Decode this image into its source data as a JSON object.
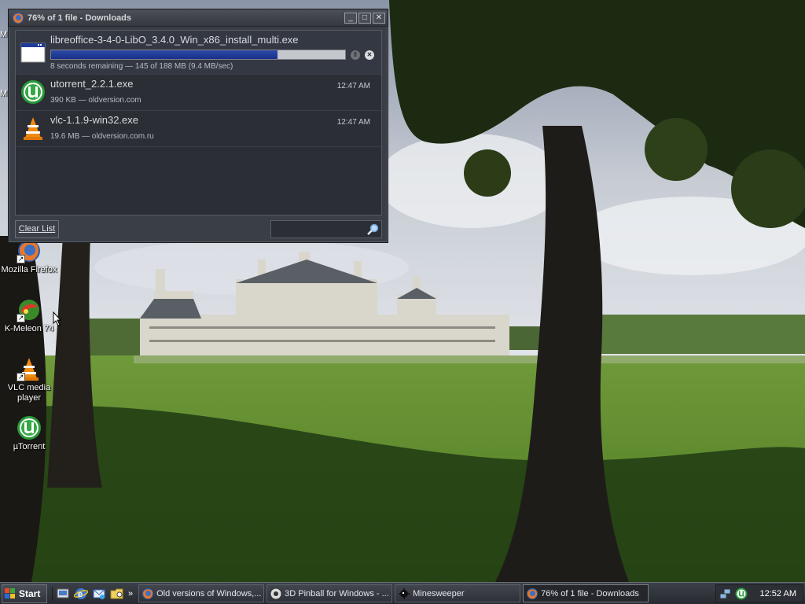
{
  "desktop": {
    "partial_labels": [
      "M",
      "M"
    ],
    "icons": [
      {
        "label": "Mozilla Firefox",
        "icon": "firefox-icon"
      },
      {
        "label": "K-Meleon 74",
        "icon": "kmeleon-icon"
      },
      {
        "label_line1": "VLC media",
        "label_line2": "player",
        "icon": "vlc-icon"
      },
      {
        "label": "µTorrent",
        "icon": "utorrent-icon"
      }
    ]
  },
  "downloads_window": {
    "title": "76% of 1 file - Downloads",
    "items": [
      {
        "filename": "libreoffice-3-4-0-LibO_3.4.0_Win_x86_install_multi.exe",
        "status": "8 seconds remaining — 145 of 188 MB (9.4 MB/sec)",
        "progress_percent": 77
      },
      {
        "filename": "utorrent_2.2.1.exe",
        "status": "390 KB — oldversion.com",
        "time": "12:47 AM"
      },
      {
        "filename": "vlc-1.1.9-win32.exe",
        "status": "19.6 MB — oldversion.com.ru",
        "time": "12:47 AM"
      }
    ],
    "clear_list_label": "Clear List",
    "search": {
      "value": "",
      "placeholder": ""
    }
  },
  "taskbar": {
    "start_label": "Start",
    "quick_launch_more": "»",
    "tasks": [
      {
        "label": "Old versions of Windows,...",
        "icon": "firefox-icon"
      },
      {
        "label": "3D Pinball for Windows - ...",
        "icon": "pinball-icon"
      },
      {
        "label": "Minesweeper",
        "icon": "minesweeper-icon"
      },
      {
        "label": "76% of 1 file - Downloads",
        "icon": "firefox-icon",
        "active": true
      }
    ],
    "clock": "12:52 AM"
  },
  "colors": {
    "window_bg": "#3a3e46",
    "list_bg": "#2b2e35",
    "progress_fill": "#1e3a9a",
    "taskbar_bg": "#2f3238"
  }
}
